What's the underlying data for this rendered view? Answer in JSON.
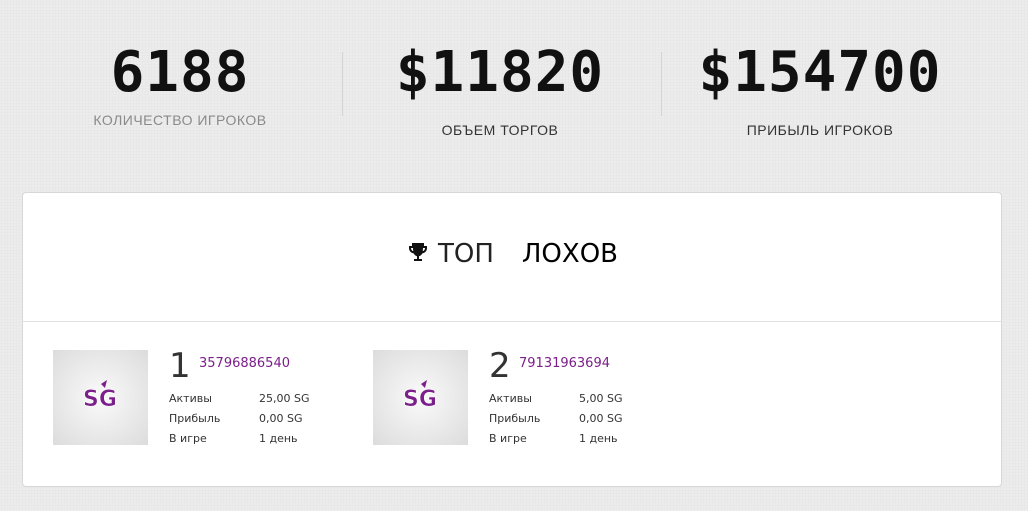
{
  "stats": [
    {
      "value": "6188",
      "label": "КОЛИЧЕСТВО ИГРОКОВ"
    },
    {
      "value": "$11820",
      "label": "ОБЪЕМ ТОРГОВ"
    },
    {
      "value": "$154700",
      "label": "ПРИБЫЛЬ ИГРОКОВ"
    }
  ],
  "top": {
    "title_a": "ТОП",
    "title_b": "ЛОХОВ",
    "icon": "trophy-icon",
    "accent": "#7b1f8a",
    "players": [
      {
        "rank": "1",
        "id": "35796886540",
        "assets_label": "Активы",
        "assets": "25,00 SG",
        "profit_label": "Прибыль",
        "profit": "0,00 SG",
        "ingame_label": "В игре",
        "ingame": "1 день"
      },
      {
        "rank": "2",
        "id": "79131963694",
        "assets_label": "Активы",
        "assets": "5,00 SG",
        "profit_label": "Прибыль",
        "profit": "0,00 SG",
        "ingame_label": "В игре",
        "ingame": "1 день"
      }
    ]
  }
}
